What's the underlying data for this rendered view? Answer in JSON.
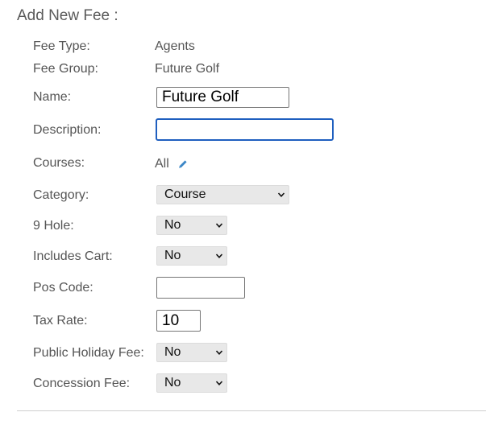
{
  "heading": "Add New Fee :",
  "fields": {
    "fee_type": {
      "label": "Fee Type:",
      "value": "Agents"
    },
    "fee_group": {
      "label": "Fee Group:",
      "value": "Future Golf"
    },
    "name": {
      "label": "Name:",
      "value": "Future Golf"
    },
    "description": {
      "label": "Description:",
      "value": ""
    },
    "courses": {
      "label": "Courses:",
      "value": "All",
      "edit_icon": "pencil-icon"
    },
    "category": {
      "label": "Category:",
      "selected": "Course"
    },
    "nine_hole": {
      "label": "9 Hole:",
      "selected": "No"
    },
    "includes_cart": {
      "label": "Includes Cart:",
      "selected": "No"
    },
    "pos_code": {
      "label": "Pos Code:",
      "value": ""
    },
    "tax_rate": {
      "label": "Tax Rate:",
      "value": "10"
    },
    "public_holiday_fee": {
      "label": "Public Holiday Fee:",
      "selected": "No"
    },
    "concession_fee": {
      "label": "Concession Fee:",
      "selected": "No"
    }
  },
  "colors": {
    "focus_border": "#1f5fbf",
    "select_bg": "#e8e8e8",
    "edit_icon": "#3b86c6"
  }
}
